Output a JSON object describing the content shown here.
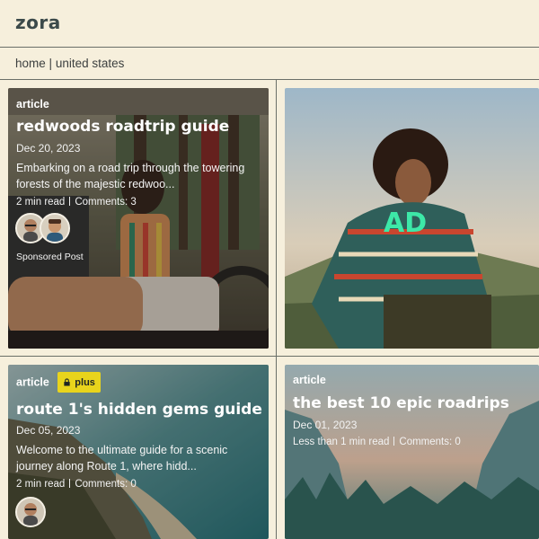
{
  "header": {
    "logo": "zora"
  },
  "breadcrumb": {
    "home": "home",
    "separator": "|",
    "current": "united states"
  },
  "cards": [
    {
      "kind": "article",
      "title": "redwoods roadtrip guide",
      "date": "Dec 20, 2023",
      "excerpt_line1": "Embarking on a road trip through the towering",
      "excerpt_line2": "forests of the majestic redwoo...",
      "read_time": "2 min read",
      "comments": "Comments: 3",
      "sponsored": "Sponsored Post"
    },
    {
      "ad_label": "AD"
    },
    {
      "kind": "article",
      "badge": "plus",
      "title": "route 1's hidden gems guide",
      "date": "Dec 05, 2023",
      "excerpt_line1": "Welcome to the ultimate guide for a scenic",
      "excerpt_line2": "journey along Route 1, where hidd...",
      "read_time": "2 min read",
      "comments": "Comments: 0"
    },
    {
      "kind": "article",
      "title": "the best 10 epic roadrips",
      "date": "Dec 01, 2023",
      "read_time": "Less than 1 min read",
      "comments": "Comments: 0"
    }
  ],
  "colors": {
    "background": "#f6efdc",
    "divider": "#6a6f68",
    "plus_badge": "#e9d41c",
    "ad_text": "#3de8a8"
  }
}
